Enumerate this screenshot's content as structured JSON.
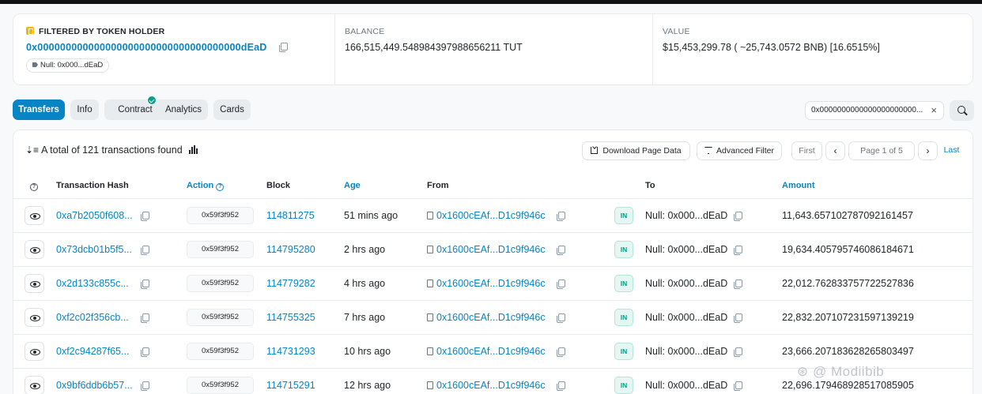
{
  "summary": {
    "filter_label": "FILTERED BY TOKEN HOLDER",
    "holder_address": "0x000000000000000000000000000000000000dEaD",
    "holder_tag": "Null: 0x000...dEaD",
    "balance_label": "BALANCE",
    "balance_value": "166,515,449.548984397988656211 TUT",
    "value_label": "VALUE",
    "value_value": "$15,453,299.78 ( ~25,743.0572 BNB) [16.6515%]"
  },
  "tabs": [
    {
      "label": "Transfers",
      "active": true
    },
    {
      "label": "Info",
      "active": false
    },
    {
      "label": "Contract",
      "active": false
    },
    {
      "label": "Analytics",
      "active": false
    },
    {
      "label": "Cards",
      "active": false
    }
  ],
  "search_chip": "0x0000000000000000000000...",
  "toolbar": {
    "total_text": "A total of 121 transactions found",
    "download": "Download Page Data",
    "advanced_filter": "Advanced Filter",
    "first": "First",
    "page": "Page 1 of 5",
    "last": "Last"
  },
  "columns": {
    "hash": "Transaction Hash",
    "action": "Action",
    "block": "Block",
    "age": "Age",
    "from": "From",
    "to": "To",
    "amount": "Amount"
  },
  "rows": [
    {
      "hash": "0xa7b2050f608...",
      "method": "0x59f3f952",
      "block": "114811275",
      "age": "51 mins ago",
      "from": "0x1600cEAf...D1c9f946c",
      "dir": "IN",
      "to": "Null: 0x000...dEaD",
      "amount": "11,643.657102787092161457"
    },
    {
      "hash": "0x73dcb01b5f5...",
      "method": "0x59f3f952",
      "block": "114795280",
      "age": "2 hrs ago",
      "from": "0x1600cEAf...D1c9f946c",
      "dir": "IN",
      "to": "Null: 0x000...dEaD",
      "amount": "19,634.405795746086184671"
    },
    {
      "hash": "0x2d133c855c...",
      "method": "0x59f3f952",
      "block": "114779282",
      "age": "4 hrs ago",
      "from": "0x1600cEAf...D1c9f946c",
      "dir": "IN",
      "to": "Null: 0x000...dEaD",
      "amount": "22,012.762833757722527836"
    },
    {
      "hash": "0xf2c02f356cb...",
      "method": "0x59f3f952",
      "block": "114755325",
      "age": "7 hrs ago",
      "from": "0x1600cEAf...D1c9f946c",
      "dir": "IN",
      "to": "Null: 0x000...dEaD",
      "amount": "22,832.207107231597139219"
    },
    {
      "hash": "0xf2c94287f65...",
      "method": "0x59f3f952",
      "block": "114731293",
      "age": "10 hrs ago",
      "from": "0x1600cEAf...D1c9f946c",
      "dir": "IN",
      "to": "Null: 0x000...dEaD",
      "amount": "23,666.207183628265803497"
    },
    {
      "hash": "0x9bf6ddb6b57...",
      "method": "0x59f3f952",
      "block": "114715291",
      "age": "12 hrs ago",
      "from": "0x1600cEAf...D1c9f946c",
      "dir": "IN",
      "to": "Null: 0x000...dEaD",
      "amount": "22,696.179468928517085905"
    }
  ],
  "watermark": "Modiibib",
  "colors": {
    "accent": "#0784c3",
    "in_badge": "#00a186",
    "filter_icon": "#f5b800"
  }
}
